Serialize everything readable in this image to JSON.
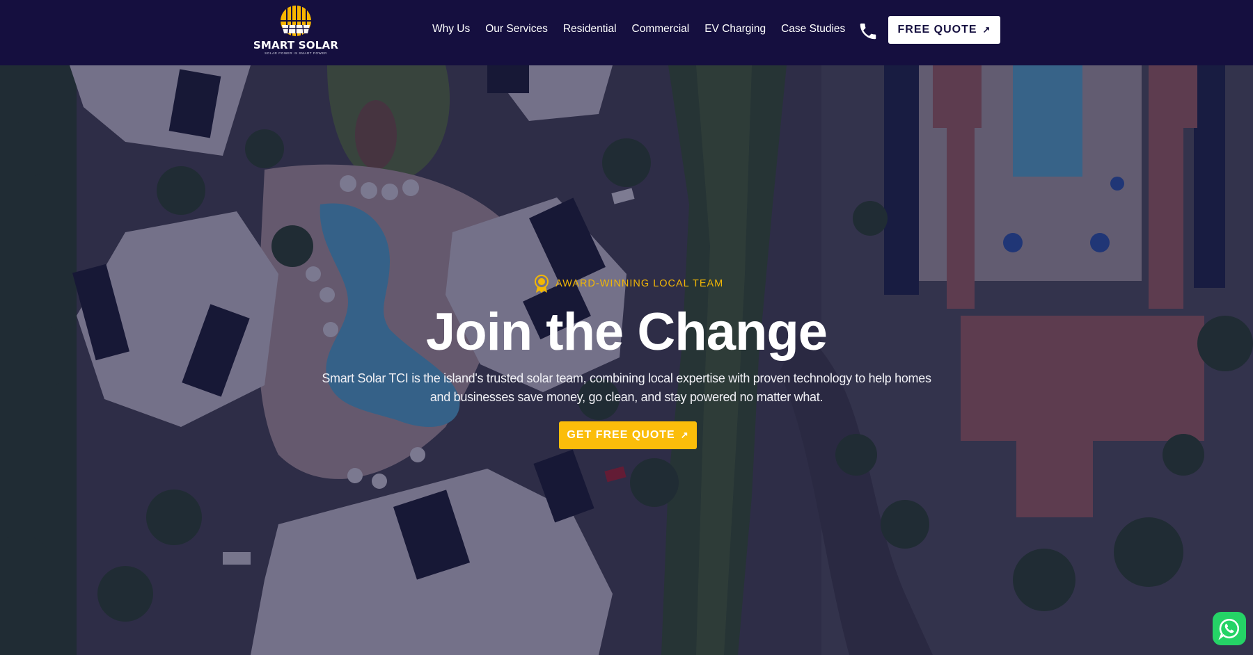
{
  "brand": {
    "name": "SMART SOLAR",
    "tagline": "SOLAR POWER IS SMART POWER"
  },
  "nav": {
    "items": [
      {
        "label": "Why Us"
      },
      {
        "label": "Our Services"
      },
      {
        "label": "Residential"
      },
      {
        "label": "Commercial"
      },
      {
        "label": "EV Charging"
      },
      {
        "label": "Case Studies"
      }
    ],
    "phone_icon": "phone-icon",
    "quote_label": "FREE QUOTE",
    "quote_icon": "arrow-up-right-icon"
  },
  "hero": {
    "badge": "AWARD-WINNING LOCAL TEAM",
    "badge_icon": "award-medal-icon",
    "title": "Join the Change",
    "description": "Smart Solar TCI is the island's trusted solar team, combining local expertise with proven technology to help homes and businesses save money, go clean, and stay powered no matter what.",
    "cta_label": "GET FREE QUOTE",
    "cta_icon": "arrow-up-right-icon",
    "background": "aerial-resort-photo"
  },
  "whatsapp": {
    "icon": "whatsapp-icon"
  },
  "colors": {
    "nav_bg": "#150f3f",
    "accent": "#fbbd0a",
    "badge": "#f2b705",
    "whatsapp": "#25d366"
  }
}
